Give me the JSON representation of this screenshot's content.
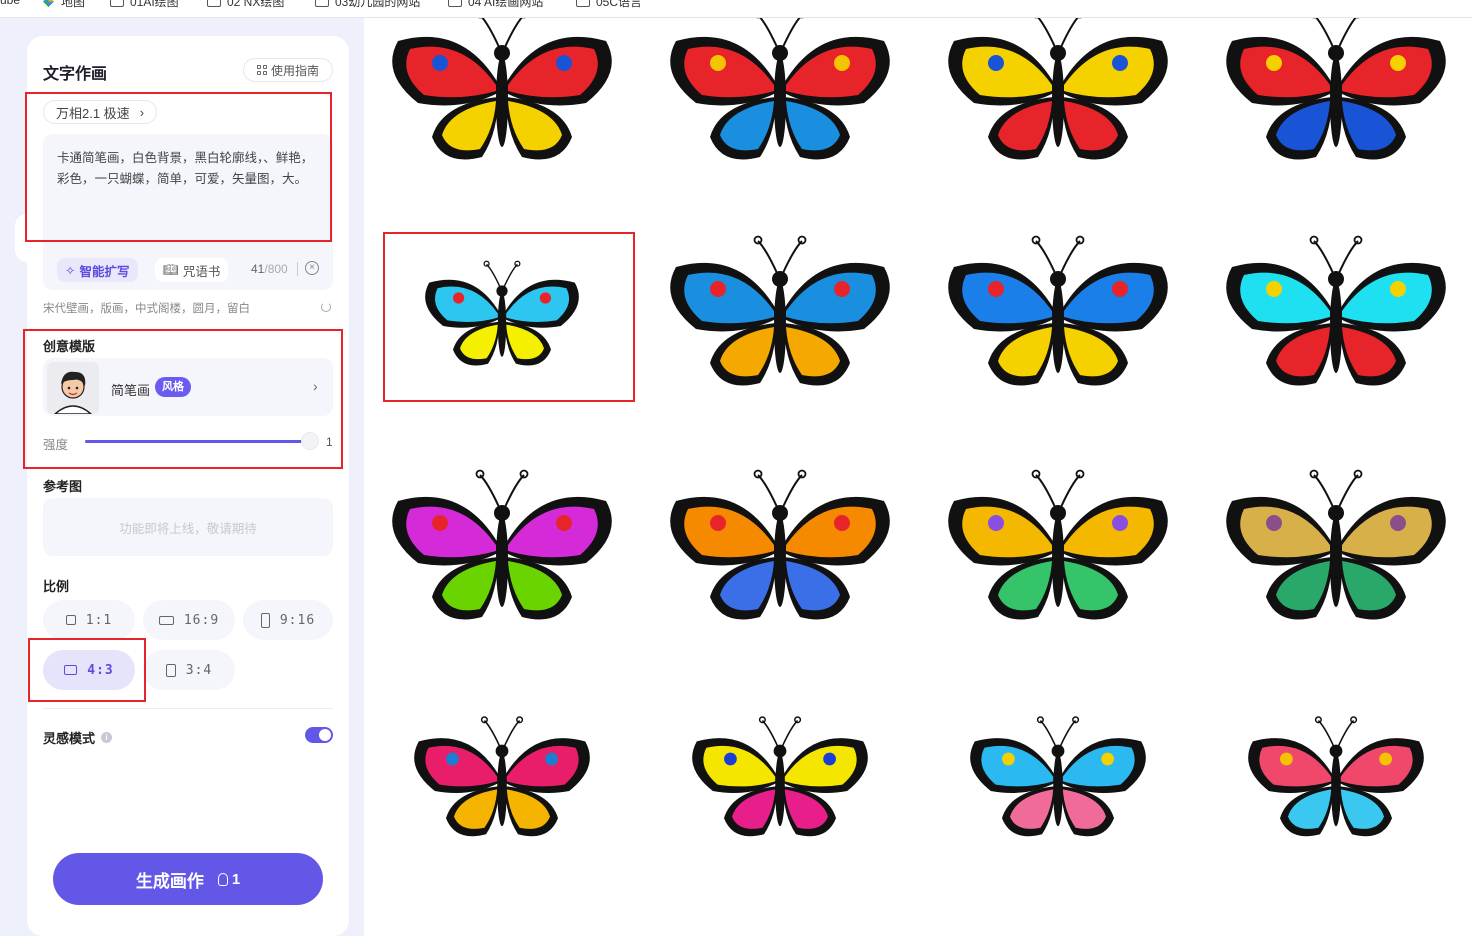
{
  "bookmarks": [
    {
      "label": "ube",
      "icon": "none"
    },
    {
      "label": "地图",
      "icon": "map-icon"
    },
    {
      "label": "01AI绘图",
      "icon": "folder-icon"
    },
    {
      "label": "02 NX绘图",
      "icon": "folder-icon"
    },
    {
      "label": "03幼儿园的网站",
      "icon": "folder-icon"
    },
    {
      "label": "04 AI绘画网站",
      "icon": "folder-icon"
    },
    {
      "label": "05C语言",
      "icon": "folder-icon"
    }
  ],
  "panel": {
    "title": "文字作画",
    "guide_label": "使用指南",
    "model_label": "万相2.1 极速",
    "prompt_text": "卡通简笔画，白色背景，黑白轮廓线，、鲜艳，彩色，一只蝴蝶，简单，可爱，矢量图，大。",
    "smart_expand_label": "智能扩写",
    "spellbook_label": "咒语书",
    "char_count": "41",
    "char_max": "/800",
    "hint_tags": "宋代壁画，版画，中式阁楼，圆月，留白",
    "template_section": "创意模版",
    "template_name": "简笔画",
    "template_badge": "风格",
    "strength_label": "强度",
    "strength_value": "1",
    "strength_level": 1.0,
    "reference_section": "参考图",
    "reference_placeholder": "功能即将上线，敬请期待",
    "ratio_section": "比例",
    "ratios": [
      {
        "label": "1:1",
        "selected": false
      },
      {
        "label": "16:9",
        "selected": false
      },
      {
        "label": "9:16",
        "selected": false
      },
      {
        "label": "4:3",
        "selected": true
      },
      {
        "label": "3:4",
        "selected": false
      }
    ],
    "inspiration_label": "灵感模式",
    "inspiration_on": true,
    "generate_label": "生成画作",
    "generate_cost": "1"
  },
  "gallery": {
    "selected_index": 4,
    "items": [
      {
        "name": "butterfly-red-yellow-black",
        "colors": [
          "#111111",
          "#e8242b",
          "#f5d100",
          "#1a54d6"
        ]
      },
      {
        "name": "butterfly-red-blue-orange",
        "colors": [
          "#111111",
          "#e8242b",
          "#1a8fe0",
          "#f5c400"
        ]
      },
      {
        "name": "butterfly-black-yellow-red",
        "colors": [
          "#111111",
          "#f5d100",
          "#e8242b",
          "#1a54d6"
        ]
      },
      {
        "name": "butterfly-black-red-blue",
        "colors": [
          "#111111",
          "#e8242b",
          "#1a54d6",
          "#f5d100"
        ]
      },
      {
        "name": "butterfly-cyan-yellow-small",
        "colors": [
          "#111111",
          "#2cc6f0",
          "#f5f000",
          "#e8242b"
        ]
      },
      {
        "name": "butterfly-blue-orange",
        "colors": [
          "#111111",
          "#1a8fe0",
          "#f5a800",
          "#e8242b"
        ]
      },
      {
        "name": "butterfly-blue-yellow-red",
        "colors": [
          "#111111",
          "#1a7fe8",
          "#f5d100",
          "#e8242b"
        ]
      },
      {
        "name": "butterfly-cyan-red-yellow",
        "colors": [
          "#111111",
          "#1ee0f0",
          "#e8242b",
          "#f5d100"
        ]
      },
      {
        "name": "butterfly-rainbow-green-purple",
        "colors": [
          "#111111",
          "#d42ad8",
          "#6ad400",
          "#e8242b"
        ]
      },
      {
        "name": "butterfly-rainbow-orange-blue",
        "colors": [
          "#111111",
          "#f58a00",
          "#3a6fe8",
          "#e8242b"
        ]
      },
      {
        "name": "butterfly-rainbow-yellow-green",
        "colors": [
          "#111111",
          "#f5b800",
          "#36c46a",
          "#8a4fe0"
        ]
      },
      {
        "name": "butterfly-gradient-olive-purple",
        "colors": [
          "#111111",
          "#d8b04a",
          "#2aa86a",
          "#8a4f8a"
        ]
      },
      {
        "name": "butterfly-pink-yellow-blue",
        "colors": [
          "#111111",
          "#e81e6a",
          "#f5b400",
          "#1a7fd0"
        ]
      },
      {
        "name": "butterfly-yellow-pink-blue",
        "colors": [
          "#111111",
          "#f5e600",
          "#e81e8a",
          "#1a3fd6"
        ]
      },
      {
        "name": "butterfly-cyan-pink-yellow",
        "colors": [
          "#111111",
          "#2cb8f0",
          "#f06a9a",
          "#f5d100"
        ]
      },
      {
        "name": "butterfly-pink-cyan-yellow",
        "colors": [
          "#111111",
          "#f0486a",
          "#3ac8f0",
          "#f5c400"
        ]
      }
    ]
  }
}
